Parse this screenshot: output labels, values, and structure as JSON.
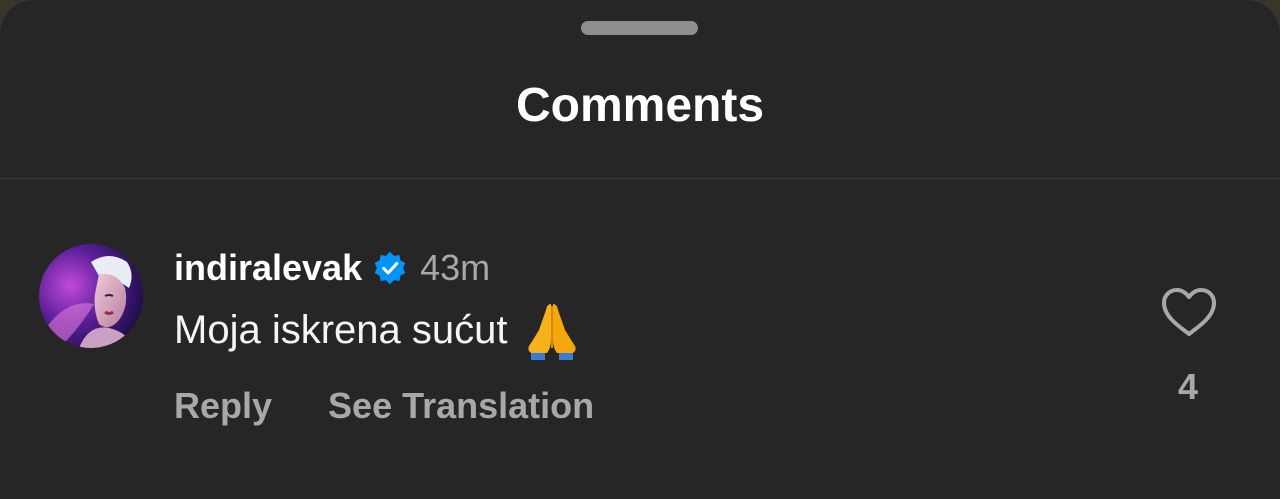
{
  "sheet": {
    "title": "Comments"
  },
  "comment": {
    "username": "indiralevak",
    "verified": true,
    "timestamp": "43m",
    "text": "Moja iskrena sućut",
    "emoji": "folded-hands",
    "actions": {
      "reply_label": "Reply",
      "translate_label": "See Translation"
    },
    "likes": {
      "count": "4",
      "icon": "heart-outline-icon"
    },
    "avatar_icon": "profile-photo"
  },
  "colors": {
    "background": "#262626",
    "text_primary": "#ffffff",
    "text_secondary": "#a8a8a8",
    "verified_badge": "#0095f6"
  }
}
